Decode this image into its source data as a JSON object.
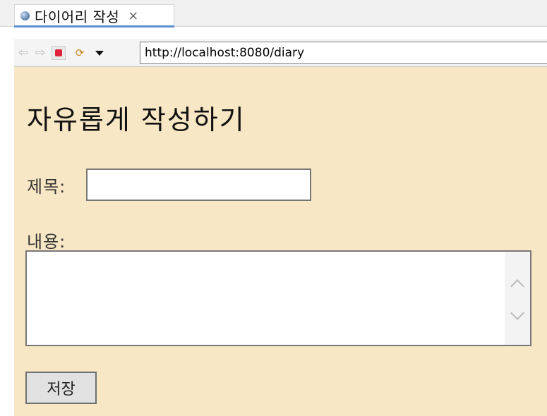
{
  "browser": {
    "tab": {
      "title": "다이어리 작성",
      "close_glyph": "×",
      "icon": "globe-icon"
    },
    "toolbar": {
      "back_glyph": "⇦",
      "forward_glyph": "⇨",
      "stop_icon": "stop-icon",
      "refresh_glyph": "⟳",
      "menu_icon": "dropdown-triangle-icon",
      "url": "http://localhost:8080/diary"
    }
  },
  "page": {
    "background_color": "#f8e7c4",
    "heading": "자유롭게 작성하기",
    "form": {
      "title_label": "제목:",
      "title_value": "",
      "content_label": "내용:",
      "content_value": "",
      "save_button": "저장"
    },
    "scrollbar": {
      "up_icon": "chevron-up-icon",
      "down_icon": "chevron-down-icon"
    }
  }
}
